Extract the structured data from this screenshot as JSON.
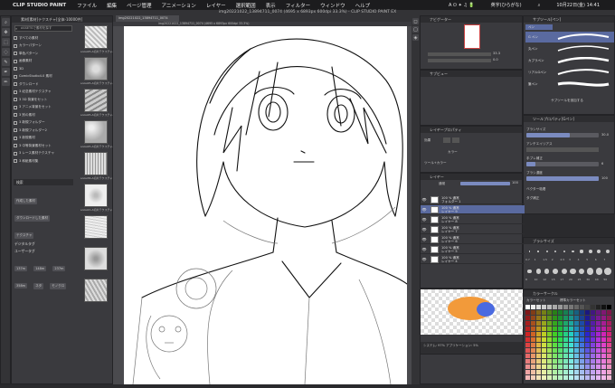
{
  "menubar": {
    "apple": "",
    "app_name": "CLIP STUDIO PAINT",
    "items": [
      "ファイル",
      "編集",
      "ページ管理",
      "アニメーション",
      "レイヤー",
      "選択範囲",
      "表示",
      "フィルター",
      "ウィンドウ",
      "ヘルプ"
    ],
    "status_icons": "A  ⏻  ✦  ♫  🔋",
    "input": "英字(ひらがな)",
    "datetime": "10月22日(金) 14:41"
  },
  "window_title": "img20221022_13894711_0074 (4695 x 6893px 600dpi 33.3%) - CLIP STUDIO PAINT EX",
  "canvas": {
    "tab_label": "img20221022_13894711_0074",
    "title_short": "img20221022_13894711_0074 (4695 x 6893px 600dpi 33.3%)"
  },
  "material": {
    "header": "素材[素材]テクスチャ[全体-10000件]",
    "search_placeholder": "ASSETSで素材を探す",
    "tree": [
      "すべての素材",
      "カラーパターン",
      "単色パターン",
      "画像素材",
      "3D",
      "ComicStudio4.0 素材",
      "ダウンロード",
      "3 紀念素材テクスチャ",
      "3 3D 背景をセット",
      "3 アニメ背景をセット",
      "3 別の素材",
      "3 新規フォルダー",
      "3 新規フォルダー2",
      "3 新規素材",
      "3 中等背景素材セット",
      "3 レース素材テクスチャ",
      "3 和紙素材集"
    ],
    "thumbs": [
      "sozai25-A切片テクスチャ-1",
      "sozai25-A切片テクスチャ-7",
      "sozai25-A切片テクスチャ-8",
      "sozai25-A切片テクスチャ-10",
      "sozai36-A切片テクスチャ",
      "sozai21-A切片テクスチャ"
    ],
    "tag_header": "検索",
    "tags": [
      "作成した素材",
      "ダウンロードした素材",
      "テクスチャ",
      "デジタルタグ",
      "ユーザータグ",
      "137m",
      "148m",
      "237m",
      "358m",
      "ネタ",
      "モノクロ"
    ],
    "tags_label_1": "デジタルタグ",
    "tags_label_2": "ユーザータグ"
  },
  "navigator": {
    "header": "ナビゲーター",
    "zoom": "33.3",
    "rotate": "0.0",
    "subview_header": "サブビュー"
  },
  "layer_property": {
    "header": "レイヤープロパティ",
    "effect_label": "効果",
    "color_label": "カラー",
    "tone_label": "ツール+カラー"
  },
  "layers": {
    "header": "レイヤー",
    "blend": "通常",
    "opacity": "100",
    "rows": [
      {
        "label": "100 % 通常\nフォルダー 1",
        "sel": false
      },
      {
        "label": "100 % 通常\nレイヤー 9",
        "sel": true
      },
      {
        "label": "100 % 通常\nレイヤー 8",
        "sel": false
      },
      {
        "label": "100 % 通常\nレイヤー 7",
        "sel": false
      },
      {
        "label": "100 % 通常\nレイヤー 6",
        "sel": false
      },
      {
        "label": "100 % 通常\nレイヤー 5",
        "sel": false
      },
      {
        "label": "100 % 通常\nレイヤー 4",
        "sel": false
      }
    ]
  },
  "subtool": {
    "header": "サブツール[ペン]",
    "group": "ペン",
    "brushes": [
      "G ペン",
      "丸ペン",
      "カブラペン",
      "リアルGペン",
      "レーザーペン",
      "ミリペン",
      "筆ペン",
      "ステッチ"
    ],
    "add_label": "サブツールを追加する"
  },
  "tool_property": {
    "header": "ツールプロパティ[Gペン]",
    "brush_size_label": "ブラシサイズ",
    "brush_size": "30.0",
    "aa_label": "アンチエイリアス",
    "stab_label": "手ブレ補正",
    "stab_value": "6",
    "brush_density_label": "ブラシ濃度",
    "brush_density": "100",
    "vector_label": "ベクター吸着",
    "vector_sub": "タグ補正"
  },
  "brush_size": {
    "header": "ブラシサイズ",
    "sizes": [
      "0.7",
      "1",
      "1.5",
      "2",
      "2.5",
      "3",
      "4",
      "5",
      "6",
      "7",
      "8",
      "10",
      "12",
      "15",
      "17",
      "20",
      "25",
      "30",
      "40",
      "50"
    ]
  },
  "color_circle": {
    "header": "カラーサークル",
    "color_set": "カラーセット",
    "set_name": "標準カラーセット"
  },
  "color_history": {
    "info": "システム: 97%   アプリケーション: 5%"
  },
  "colors": {
    "accent": "#6b7bb5",
    "panel": "#3a3a3e",
    "bg": "#2a2a2d",
    "selected_layer": "#5a6aa0"
  }
}
